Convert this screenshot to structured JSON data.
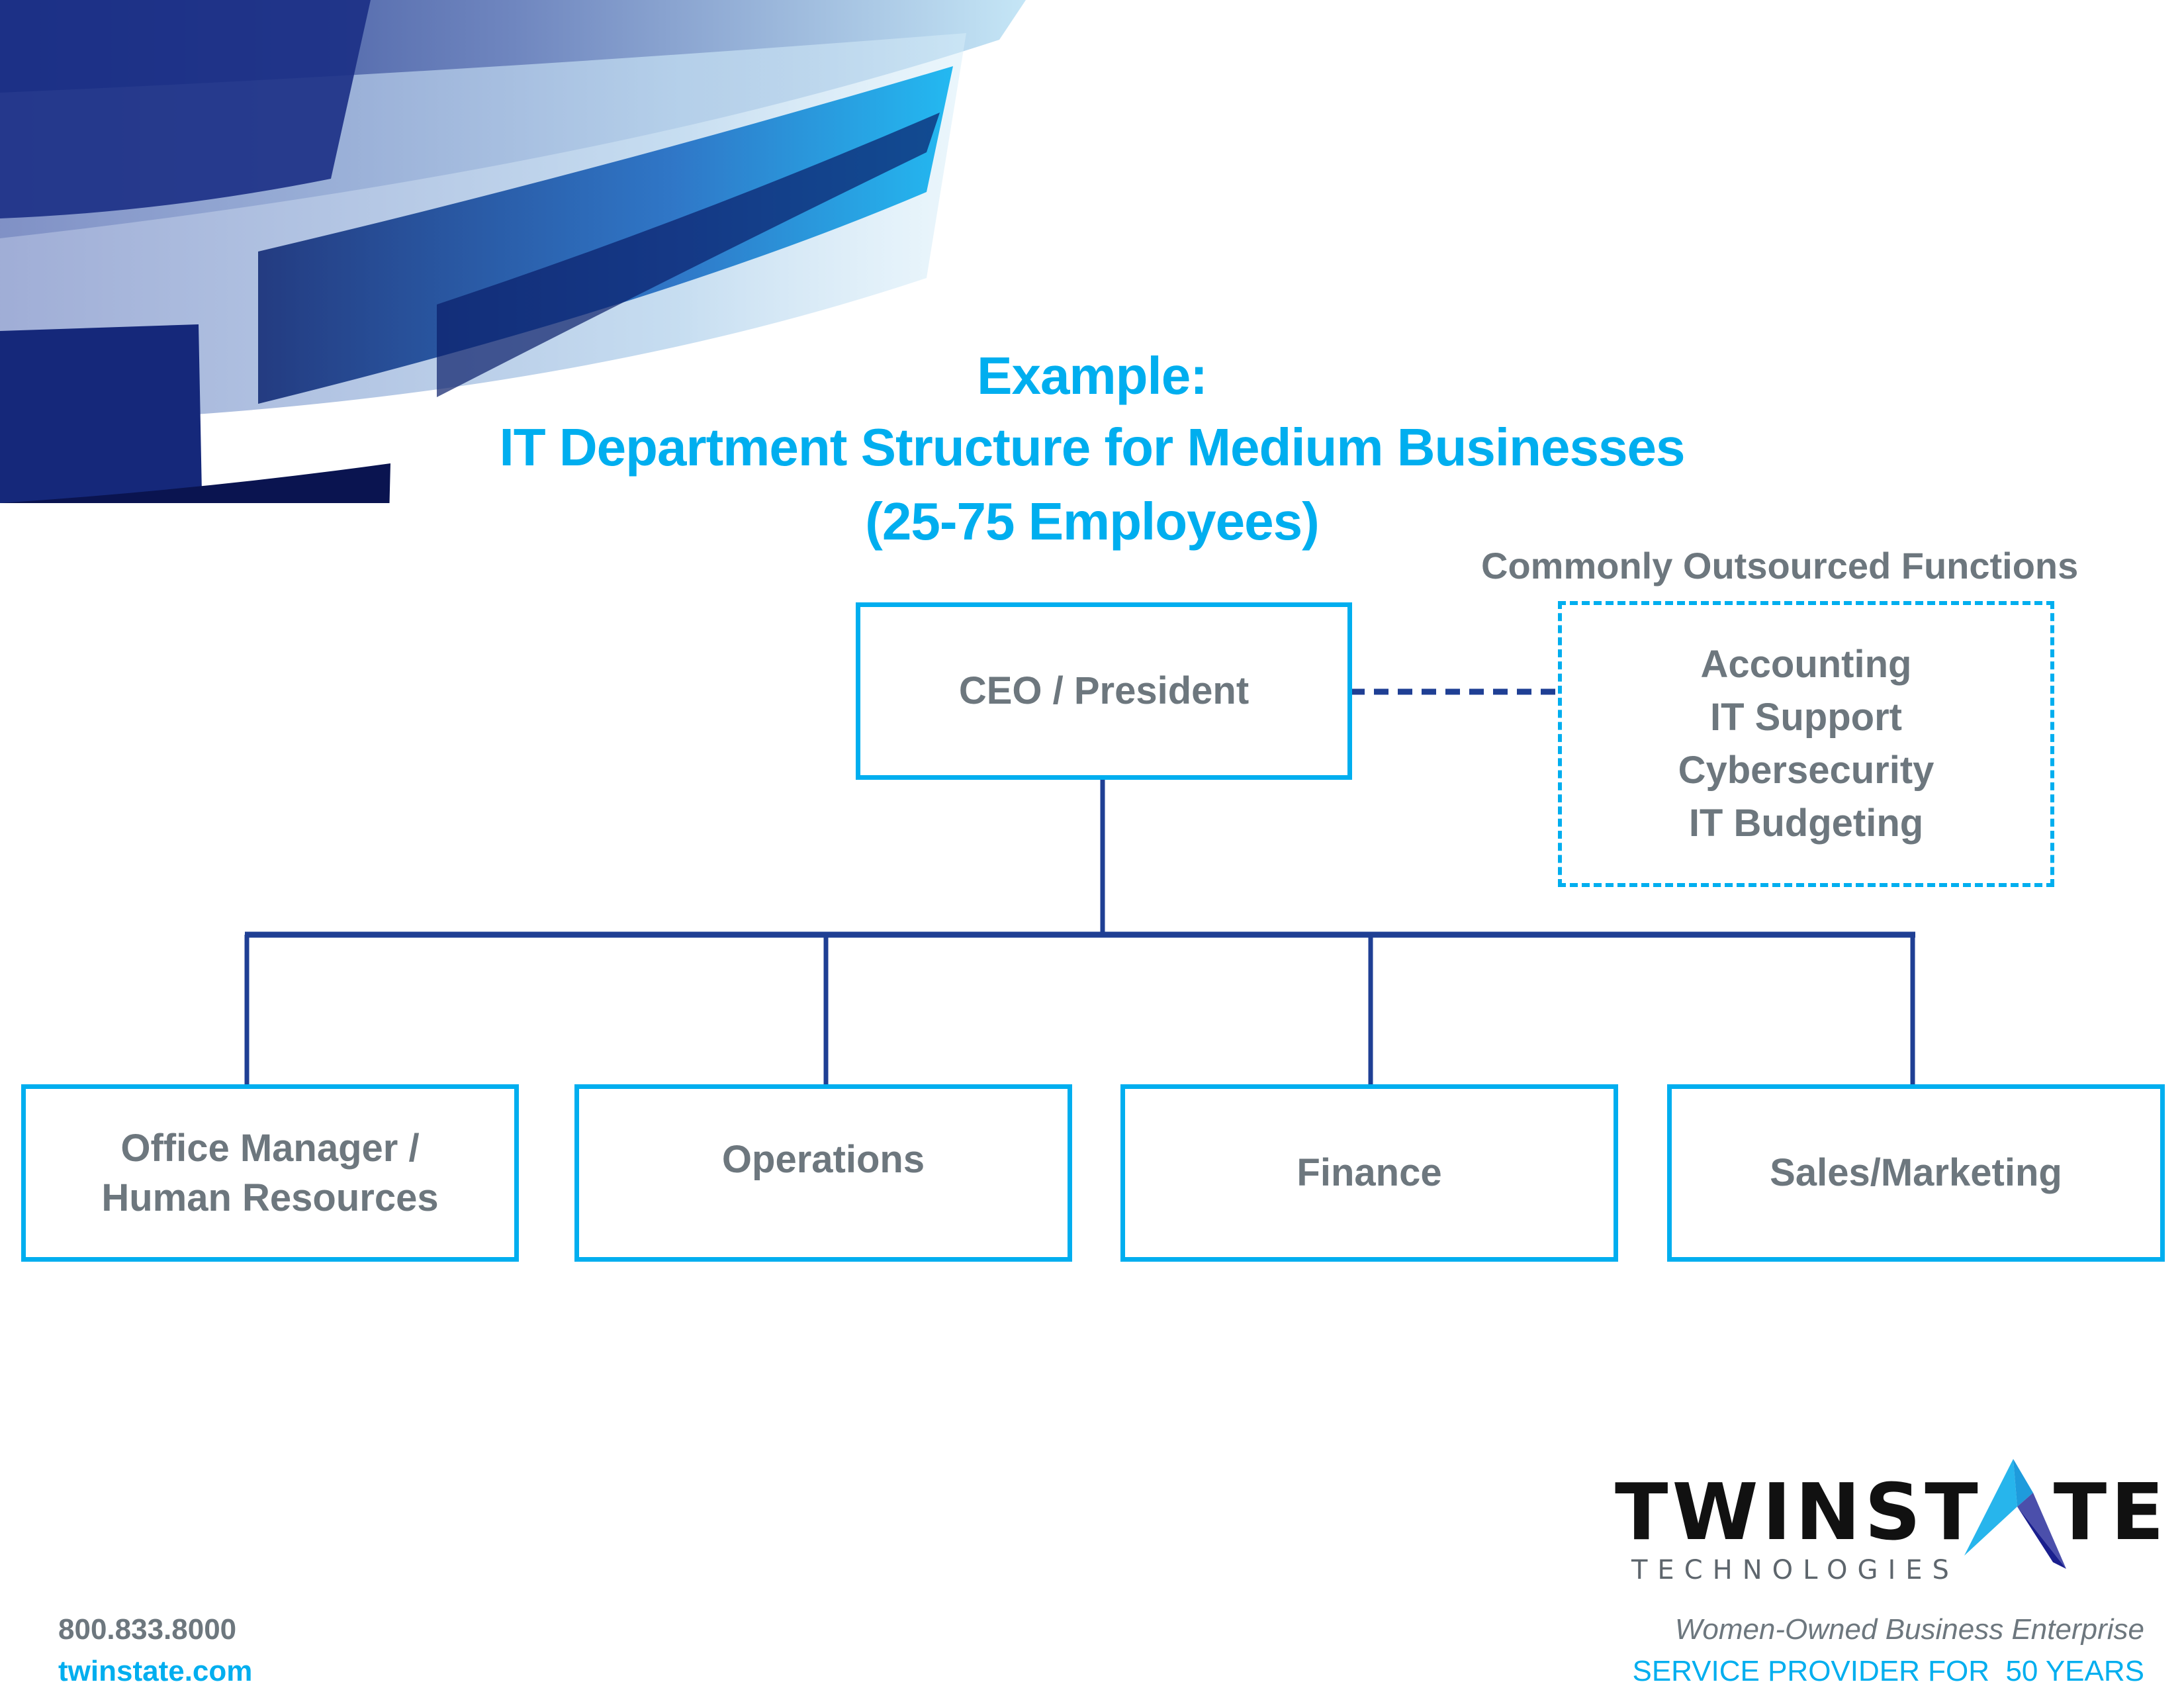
{
  "title": {
    "line1": "Example:",
    "line2": "IT Department Structure for Medium Businesses",
    "line3": "(25-75 Employees)"
  },
  "org_chart": {
    "root": {
      "label": "CEO / President"
    },
    "outsourced": {
      "heading": "Commonly Outsourced Functions",
      "items": [
        "Accounting",
        "IT Support",
        "Cybersecurity",
        "IT Budgeting"
      ],
      "connector_style": "dashed"
    },
    "departments": [
      {
        "line1": "Office Manager /",
        "line2": "Human Resources"
      },
      {
        "line1": "Operations",
        "line2": ""
      },
      {
        "line1": "Finance",
        "line2": ""
      },
      {
        "line1": "Sales/Marketing",
        "line2": ""
      }
    ]
  },
  "colors": {
    "accent": "#00aeef",
    "connector": "#1f3f94",
    "text_gray": "#6d777e"
  },
  "footer": {
    "phone": "800.833.8000",
    "website": "twinstate.com",
    "tagline": "Women-Owned Business Enterprise",
    "service": "SERVICE PROVIDER FOR  50 YEARS"
  },
  "logo": {
    "wordmark_part1": "TWINST",
    "wordmark_part2": "TE",
    "subtitle": "TECHNOLOGIES",
    "icon": "arrow-a-icon"
  }
}
